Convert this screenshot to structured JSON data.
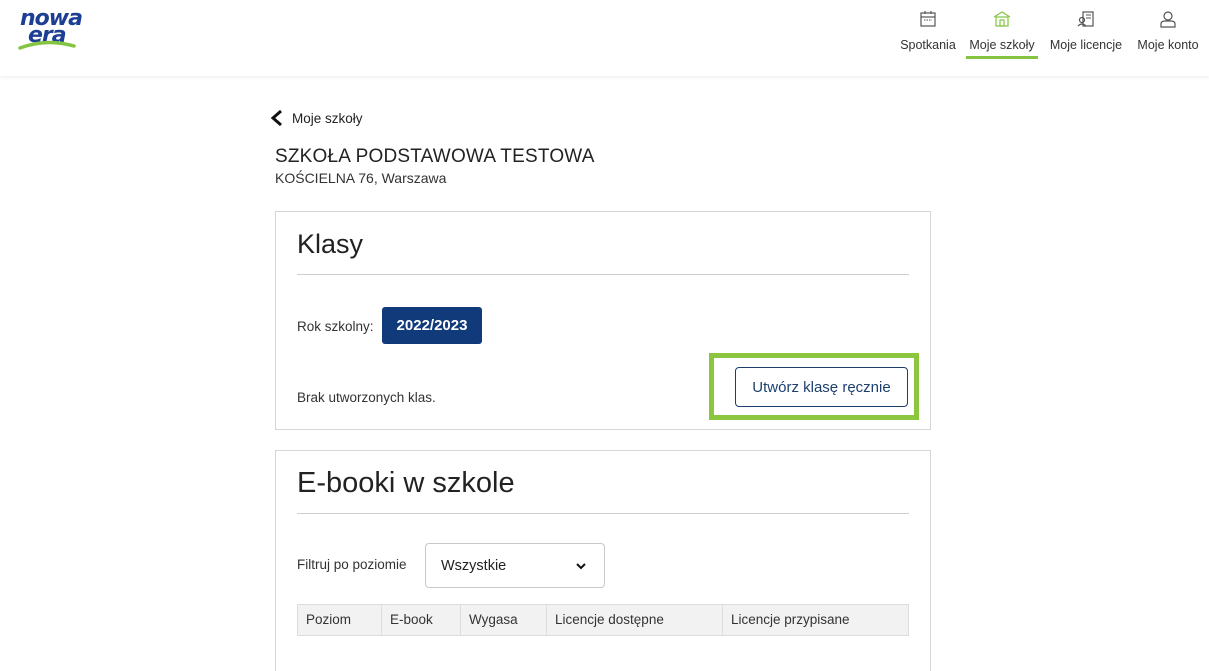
{
  "header": {
    "logo": {
      "line1": "nowa",
      "line2": "era"
    },
    "nav": [
      {
        "label": "Spotkania",
        "icon": "calendar-icon",
        "active": false
      },
      {
        "label": "Moje szkoły",
        "icon": "school-icon",
        "active": true
      },
      {
        "label": "Moje licencje",
        "icon": "license-icon",
        "active": false
      },
      {
        "label": "Moje konto",
        "icon": "user-icon",
        "active": false
      }
    ]
  },
  "breadcrumb": {
    "back_label": "Moje szkoły"
  },
  "school": {
    "name": "SZKOŁA PODSTAWOWA TESTOWA",
    "address": "KOŚCIELNA 76, Warszawa"
  },
  "klasy": {
    "title": "Klasy",
    "year_label": "Rok szkolny:",
    "year_value": "2022/2023",
    "empty_text": "Brak utworzonych klas.",
    "create_button": "Utwórz klasę ręcznie"
  },
  "ebooki": {
    "title": "E-booki w szkole",
    "filter_label": "Filtruj po poziomie",
    "filter_value": "Wszystkie",
    "columns": [
      "Poziom",
      "E-book",
      "Wygasa",
      "Licencje dostępne",
      "Licencje przypisane"
    ]
  },
  "colors": {
    "brand_blue": "#103a7a",
    "accent_green": "#84c441",
    "highlight_green": "#8cc63f"
  }
}
